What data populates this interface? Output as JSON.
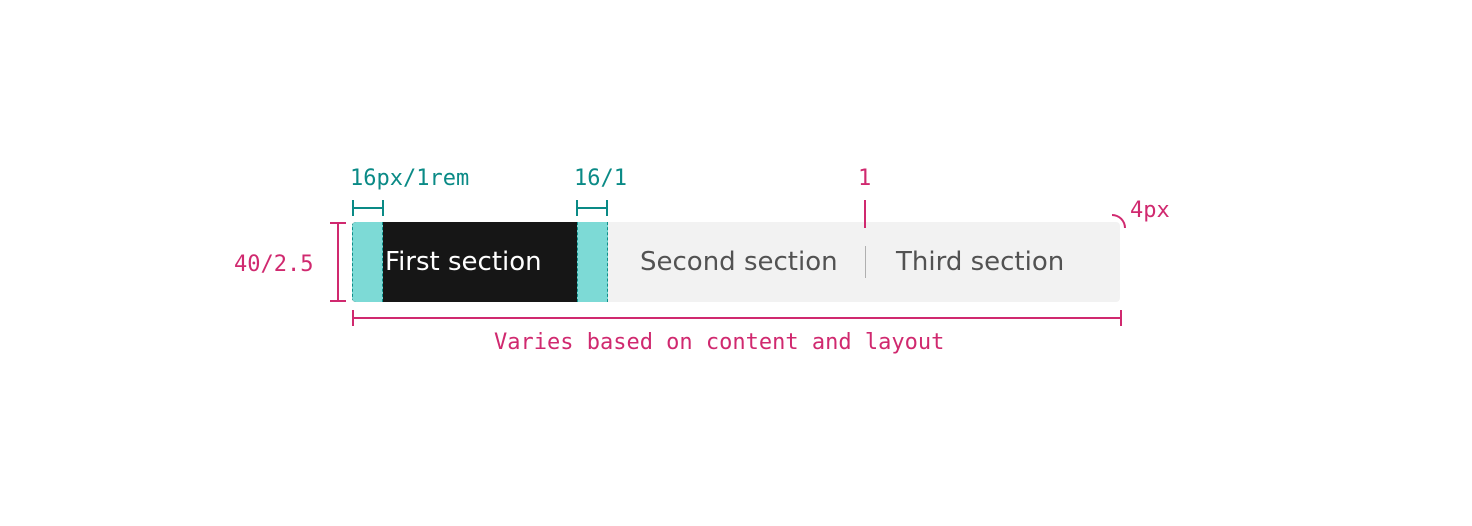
{
  "switcher": {
    "sections": [
      {
        "label": "First section",
        "selected": true
      },
      {
        "label": "Second section",
        "selected": false
      },
      {
        "label": "Third section",
        "selected": false
      }
    ]
  },
  "annotations": {
    "padding_left": "16px/1rem",
    "padding_right": "16/1",
    "divider_width": "1",
    "corner_radius": "4px",
    "height": "40/2.5",
    "width": "Varies based on content and layout"
  },
  "colors": {
    "selected_bg": "#161616",
    "unselected_bg": "#f2f2f2",
    "spacing_highlight": "#7ddad6",
    "annotation_teal": "#0a8a86",
    "annotation_magenta": "#d0296f"
  }
}
